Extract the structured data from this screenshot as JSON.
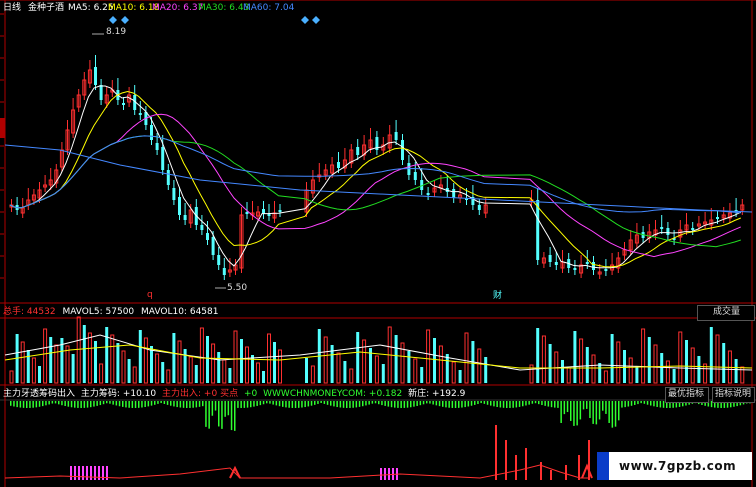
{
  "main_panel": {
    "period": "日线",
    "stock_name": "金种子酒",
    "ma5": {
      "label": "MA5:",
      "value": "6.25",
      "color": "#ffffff"
    },
    "ma10": {
      "label": "MA10:",
      "value": "6.18",
      "color": "#ffff00"
    },
    "ma20": {
      "label": "MA20:",
      "value": "6.37",
      "color": "#ff44ff"
    },
    "ma30": {
      "label": "MA30:",
      "value": "6.43",
      "color": "#22dd22"
    },
    "ma60": {
      "label": "MA60:",
      "value": "7.04",
      "color": "#4488ff"
    },
    "high_label": "8.19",
    "low_label": "5.50",
    "marker_q": "q",
    "marker_cai": "财"
  },
  "volume_panel": {
    "total_label": "总手:",
    "total_value": "44532",
    "mavol5_label": "MAVOL5:",
    "mavol5_value": "57500",
    "mavol10_label": "MAVOL10:",
    "mavol10_value": "64581",
    "button_label": "成交量"
  },
  "indicator_panel": {
    "title": "主力牙透筹码出入",
    "chip_label": "主力筹码:",
    "chip_value": "+10.10",
    "inout_label": "主力出入:",
    "inout_value": "+0",
    "buy_label": "买点",
    "buy_value": "+0",
    "site_label": "WWWCHNMONEYCOM:",
    "site_value": "+0.182",
    "xinzhuang_label": "新庄:",
    "xinzhuang_value": "+192.9",
    "button_best": "最优指标",
    "button_help": "指标说明"
  },
  "watermark": {
    "text": "www.7gpzb.com"
  },
  "colors": {
    "up": "#ff3030",
    "down": "#54ffff",
    "border": "#b00000",
    "green_bar": "#30ff30",
    "magenta": "#ff44ff"
  }
}
